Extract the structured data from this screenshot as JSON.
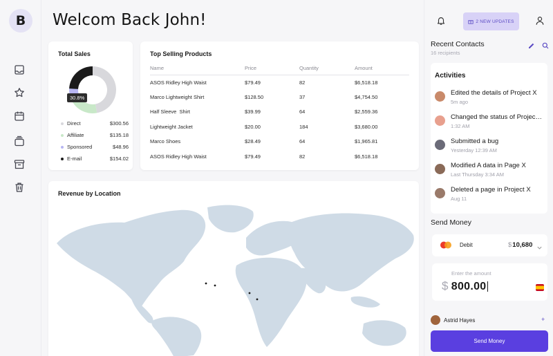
{
  "app": {
    "logo_letter": "B"
  },
  "sidebar": {
    "icons": [
      "inbox-icon",
      "star-icon",
      "calendar-icon",
      "stack-icon",
      "archive-icon",
      "trash-icon"
    ]
  },
  "header": {
    "title": "Welcom Back John!"
  },
  "total_sales": {
    "title": "Total Sales",
    "badge": "30.8%",
    "legend": [
      {
        "label": "Direct",
        "value": "$300.56",
        "color": "#d8d8dc"
      },
      {
        "label": "Affiliate",
        "value": "$135.18",
        "color": "#c8e8c8"
      },
      {
        "label": "Sponsored",
        "value": "$48.96",
        "color": "#b7b6f2"
      },
      {
        "label": "E-mail",
        "value": "$154.02",
        "color": "#1b1b1b"
      }
    ],
    "chart_data": {
      "type": "pie",
      "categories": [
        "Direct",
        "Affiliate",
        "Sponsored",
        "E-mail"
      ],
      "values": [
        300.56,
        135.18,
        48.96,
        154.02
      ]
    }
  },
  "products": {
    "title": "Top Selling Products",
    "columns": [
      "Name",
      "Price",
      "Quantity",
      "Amount"
    ],
    "rows": [
      [
        "ASOS Ridley High Waist",
        "$79.49",
        "82",
        "$6,518.18"
      ],
      [
        "Marco Lightweight Shirt",
        "$128.50",
        "37",
        "$4,754.50"
      ],
      [
        "Half Sleeve  Shirt",
        "$39.99",
        "64",
        "$2,559.36"
      ],
      [
        "Lightweight Jacket",
        "$20.00",
        "184",
        "$3,680.00"
      ],
      [
        "Marco Shoes",
        "$28.49",
        "64",
        "$1,965.81"
      ],
      [
        "ASOS Ridley High Waist",
        "$79.49",
        "82",
        "$6,518.18"
      ]
    ]
  },
  "revenue": {
    "title": "Revenue by Location"
  },
  "right": {
    "updates_label": "2 NEW UPDATES",
    "recent_contacts": {
      "title": "Recent Contacts",
      "subtitle": "16 recipients"
    },
    "activities": {
      "title": "Activities",
      "items": [
        {
          "text": "Edited the details of Project X",
          "time": "5m ago",
          "avatar": "#c98a6a"
        },
        {
          "text": "Changed the status of Project X",
          "time": "1:32 AM",
          "avatar": "#e8a08e"
        },
        {
          "text": "Submitted a bug",
          "time": "Yesterday 12:39 AM",
          "avatar": "#6b6b78"
        },
        {
          "text": "Modified A data in Page X",
          "time": "Last Thursday 3:34 AM",
          "avatar": "#8a6a58"
        },
        {
          "text": "Deleted a page in Project X",
          "time": "Aug 11",
          "avatar": "#9a7a6a"
        }
      ]
    },
    "send_money": {
      "title": "Send Money",
      "card_label": "Debit",
      "card_currency": "$",
      "card_amount": "10,680",
      "amount_placeholder": "Enter the amount",
      "amount_currency": "$",
      "amount_value": "800.00",
      "recipient_name": "Astrid Hayes",
      "recipient_add": "+",
      "button_label": "Send Money"
    }
  }
}
